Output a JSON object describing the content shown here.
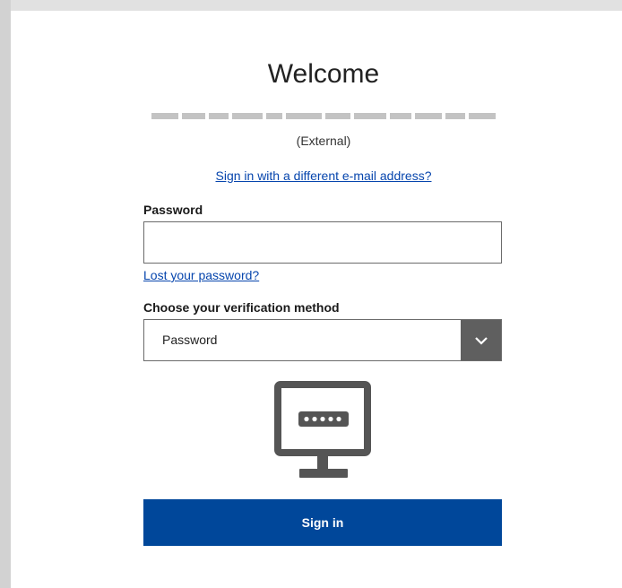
{
  "header": {
    "title": "Welcome"
  },
  "account": {
    "type": "(External)"
  },
  "links": {
    "different_email": "Sign in with a different e-mail address?",
    "lost_password": "Lost your password?"
  },
  "password": {
    "label": "Password",
    "value": "",
    "placeholder": ""
  },
  "verification": {
    "label": "Choose your verification method",
    "selected": "Password"
  },
  "illustration": {
    "icon": "monitor-password-icon"
  },
  "actions": {
    "sign_in": "Sign in"
  },
  "colors": {
    "primary_button": "#00479a",
    "link": "#0645ad",
    "select_button": "#5f5f5f"
  }
}
